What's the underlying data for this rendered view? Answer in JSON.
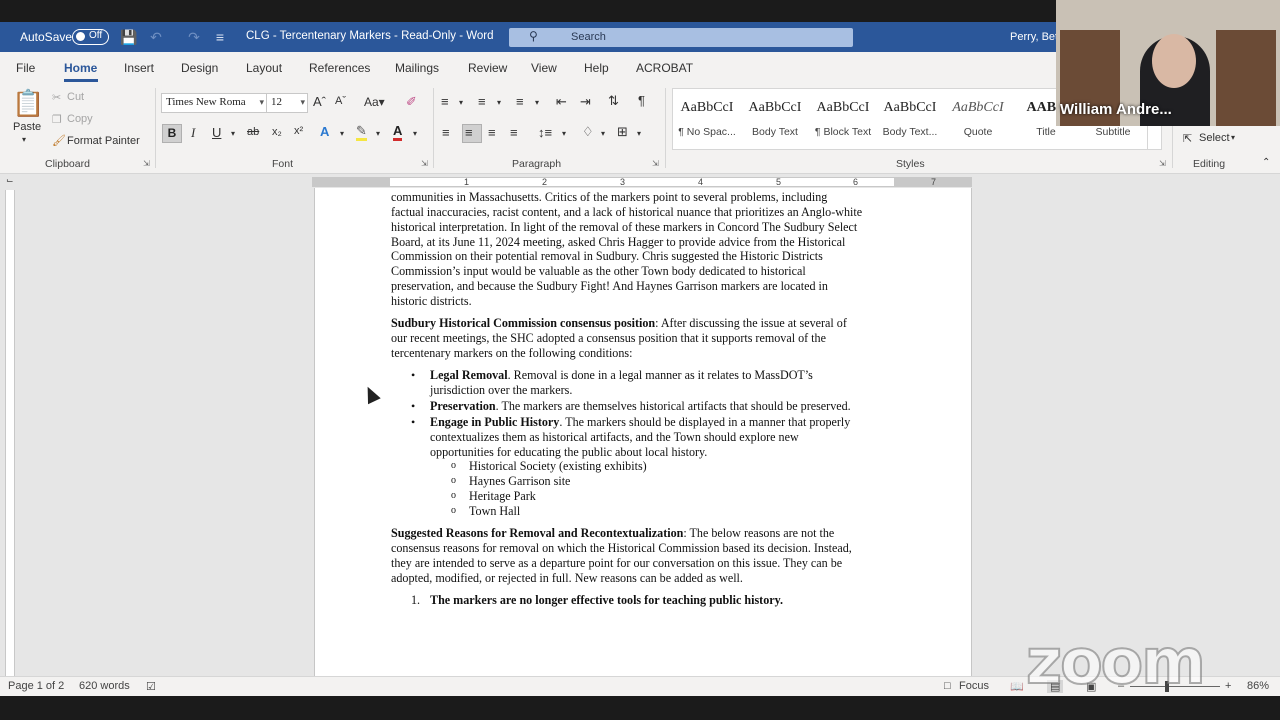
{
  "titlebar": {
    "autosave_label": "AutoSave",
    "autosave_state": "Off",
    "doc_title": "CLG - Tercentenary Markers  -  Read-Only  -  Word",
    "search_placeholder": "Search",
    "user_name": "Perry, Bet"
  },
  "tabs": [
    "File",
    "Home",
    "Insert",
    "Design",
    "Layout",
    "References",
    "Mailings",
    "Review",
    "View",
    "Help",
    "ACROBAT"
  ],
  "ribbon": {
    "clipboard": {
      "paste": "Paste",
      "cut": "Cut",
      "copy": "Copy",
      "format_painter": "Format Painter",
      "label": "Clipboard"
    },
    "font": {
      "font_name": "Times New Roma",
      "font_size": "12",
      "label": "Font"
    },
    "paragraph": {
      "label": "Paragraph"
    },
    "styles": {
      "label": "Styles",
      "items": [
        {
          "sample": "AaBbCcI",
          "name": "¶ No Spac..."
        },
        {
          "sample": "AaBbCcI",
          "name": "Body Text"
        },
        {
          "sample": "AaBbCcI",
          "name": "¶ Block Text"
        },
        {
          "sample": "AaBbCcI",
          "name": "Body Text..."
        },
        {
          "sample": "AaBbCcI",
          "name": "Quote"
        },
        {
          "sample": "AABB",
          "name": "Title"
        },
        {
          "sample": "",
          "name": "Subtitle"
        }
      ]
    },
    "editing": {
      "select": "Select",
      "label": "Editing"
    }
  },
  "ruler_numbers": [
    "1",
    "2",
    "3",
    "4",
    "5",
    "6",
    "7"
  ],
  "document": {
    "p1_lines": [
      "communities in Massachusetts.  Critics of the markers point to several problems, including",
      "factual inaccuracies, racist content, and a lack of historical nuance that prioritizes an Anglo-white",
      "historical interpretation.  In light of the removal of these markers in Concord The Sudbury Select",
      "Board, at its June 11, 2024 meeting, asked Chris Hagger to provide advice from the Historical",
      "Commission on their potential removal in Sudbury.  Chris suggested the Historic Districts",
      "Commission’s input would be valuable as the other Town body dedicated to historical",
      "preservation, and because the Sudbury Fight! And Haynes Garrison markers are located in",
      "historic districts."
    ],
    "p2_bold": "Sudbury Historical Commission consensus position",
    "p2_lines": [
      ": After discussing the issue at several of",
      "our recent meetings, the SHC adopted a consensus position that it supports removal of the",
      "tercentenary markers on the following conditions:"
    ],
    "bullets": [
      {
        "bold": "Legal Removal",
        "lines": [
          ".  Removal is done in a legal manner as it relates to MassDOT’s",
          "jurisdiction over the markers."
        ]
      },
      {
        "bold": "Preservation",
        "lines": [
          ".  The markers are themselves historical artifacts that should be preserved."
        ]
      },
      {
        "bold": "Engage in Public History",
        "lines": [
          ".  The markers should be displayed in a manner that properly",
          "contextualizes them as historical artifacts, and the Town should explore new",
          "opportunities for educating the public about local history."
        ]
      }
    ],
    "sub_bullets": [
      "Historical Society (existing exhibits)",
      "Haynes Garrison site",
      "Heritage Park",
      "Town Hall"
    ],
    "p3_bold": "Suggested Reasons for Removal and Recontextualization",
    "p3_lines": [
      ":  The below reasons are not the",
      "consensus reasons for removal on which the Historical Commission based its decision. Instead,",
      "they are intended to serve as a departure point for our conversation on this issue.  They can be",
      "adopted, modified, or rejected in full.  New reasons can be added as well."
    ],
    "numbered_1_num": "1.",
    "numbered_1": "The markers are no longer effective tools for teaching public history."
  },
  "statusbar": {
    "page": "Page 1 of 2",
    "words": "620 words",
    "focus": "Focus",
    "zoom": "86%"
  },
  "webcam": {
    "name": "William Andre..."
  },
  "watermark": "zoom"
}
